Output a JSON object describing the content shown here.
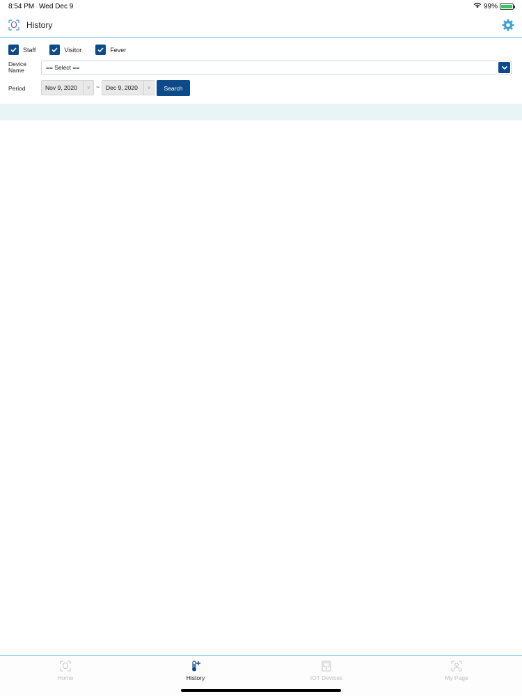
{
  "status_bar": {
    "time": "8:54 PM",
    "date": "Wed Dec 9",
    "battery": "99%",
    "battery_level": 0.99
  },
  "header": {
    "title": "History",
    "logo_icon": "face-scan-logo-icon",
    "settings_icon": "gear-icon",
    "accent_color": "#3aa0d8"
  },
  "filters": {
    "checkboxes": [
      {
        "label": "Staff",
        "checked": true
      },
      {
        "label": "Visitor",
        "checked": true
      },
      {
        "label": "Fever",
        "checked": true
      }
    ],
    "device_label": "Device Name",
    "device_select_value": "== Select ==",
    "period_label": "Period",
    "date_from": "Nov 9, 2020",
    "separator": "~",
    "date_to": "Dec 9, 2020",
    "search_label": "Search",
    "primary_color": "#0d4a8a"
  },
  "tabs": [
    {
      "label": "Home",
      "icon": "face-scan-icon",
      "active": false
    },
    {
      "label": "History",
      "icon": "thermometer-plus-icon",
      "active": true
    },
    {
      "label": "IOT Devices",
      "icon": "device-icon",
      "active": false
    },
    {
      "label": "My Page",
      "icon": "profile-scan-icon",
      "active": false
    }
  ]
}
